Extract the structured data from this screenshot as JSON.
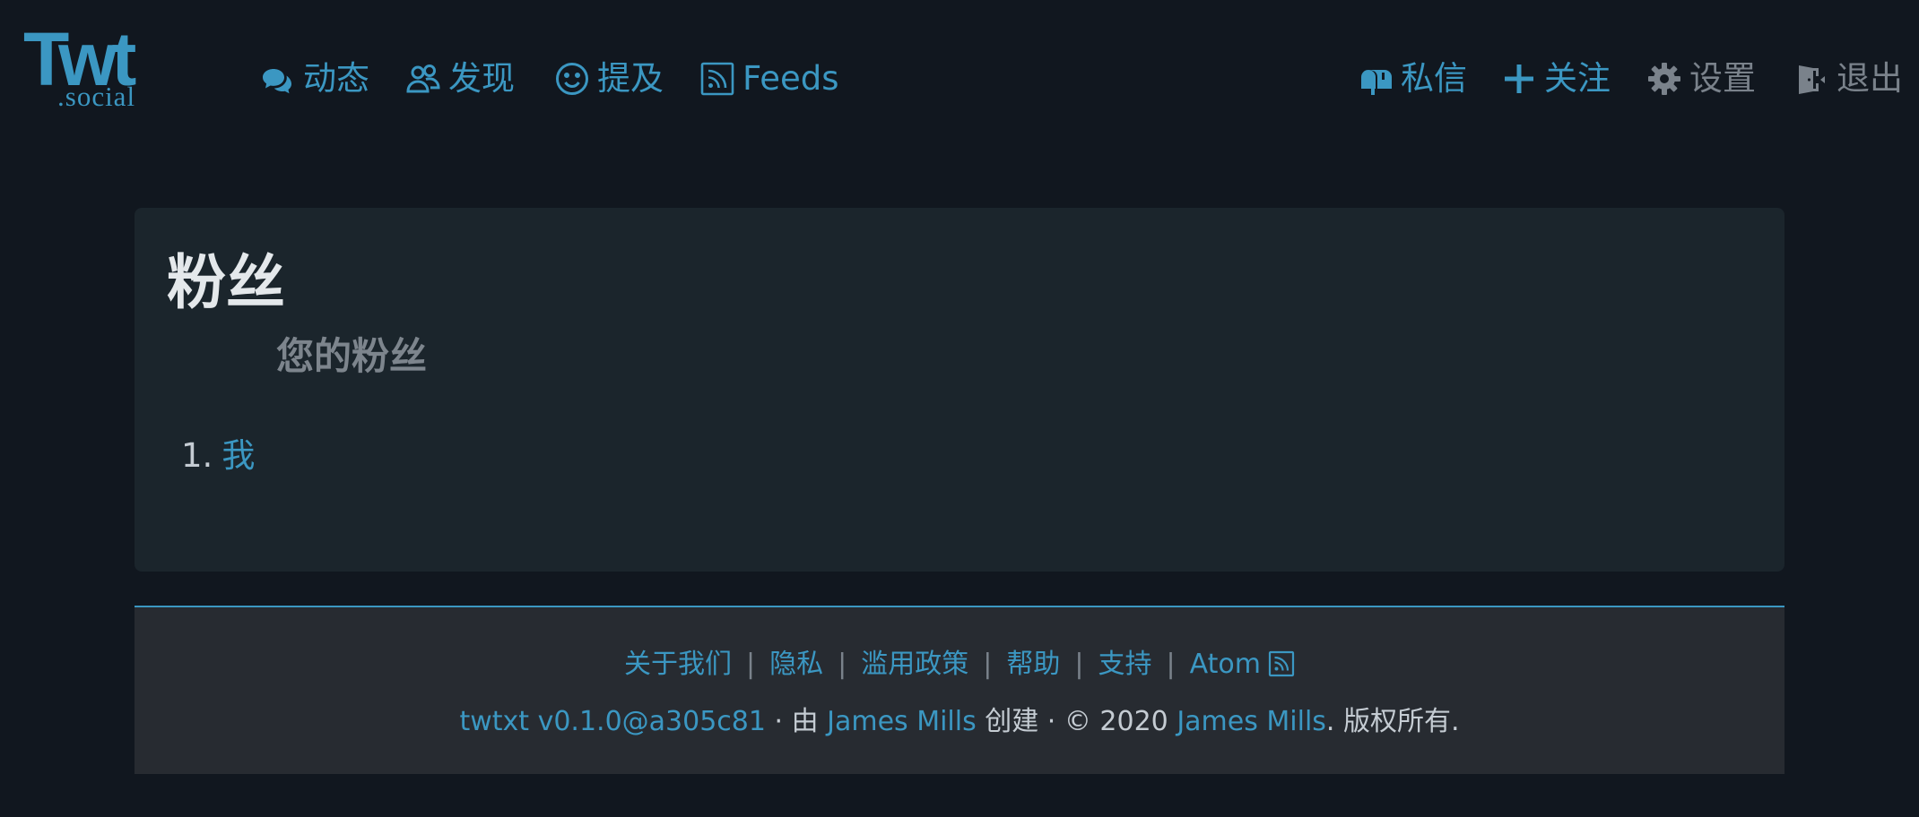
{
  "brand": {
    "logo_text": "Twt",
    "logo_sub": ".social"
  },
  "nav": {
    "left": [
      {
        "label": "动态",
        "icon": "comments-icon"
      },
      {
        "label": "发现",
        "icon": "users-icon"
      },
      {
        "label": "提及",
        "icon": "smile-icon"
      },
      {
        "label": "Feeds",
        "icon": "rss-icon"
      }
    ],
    "right": [
      {
        "label": "私信",
        "icon": "mailbox-icon"
      },
      {
        "label": "关注",
        "icon": "plus-icon"
      },
      {
        "label": "设置",
        "icon": "gear-icon"
      },
      {
        "label": "退出",
        "icon": "door-icon"
      }
    ]
  },
  "main": {
    "title": "粉丝",
    "subtitle": "您的粉丝",
    "followers": [
      {
        "number": "1.",
        "name": "我"
      }
    ]
  },
  "footer": {
    "links": [
      "关于我们",
      "隐私",
      "滥用政策",
      "帮助",
      "支持",
      "Atom"
    ],
    "separator": "|",
    "version": "twtxt v0.1.0@a305c81",
    "by_text": " · 由 ",
    "author": "James Mills",
    "created_text": " 创建 · © 2020 ",
    "copyright_holder": "James Mills",
    "rights_text": ". 版权所有."
  },
  "colors": {
    "background": "#11171f",
    "card": "#1b252c",
    "footer": "#272b31",
    "accent": "#3b97c2",
    "muted": "#7a828b"
  }
}
